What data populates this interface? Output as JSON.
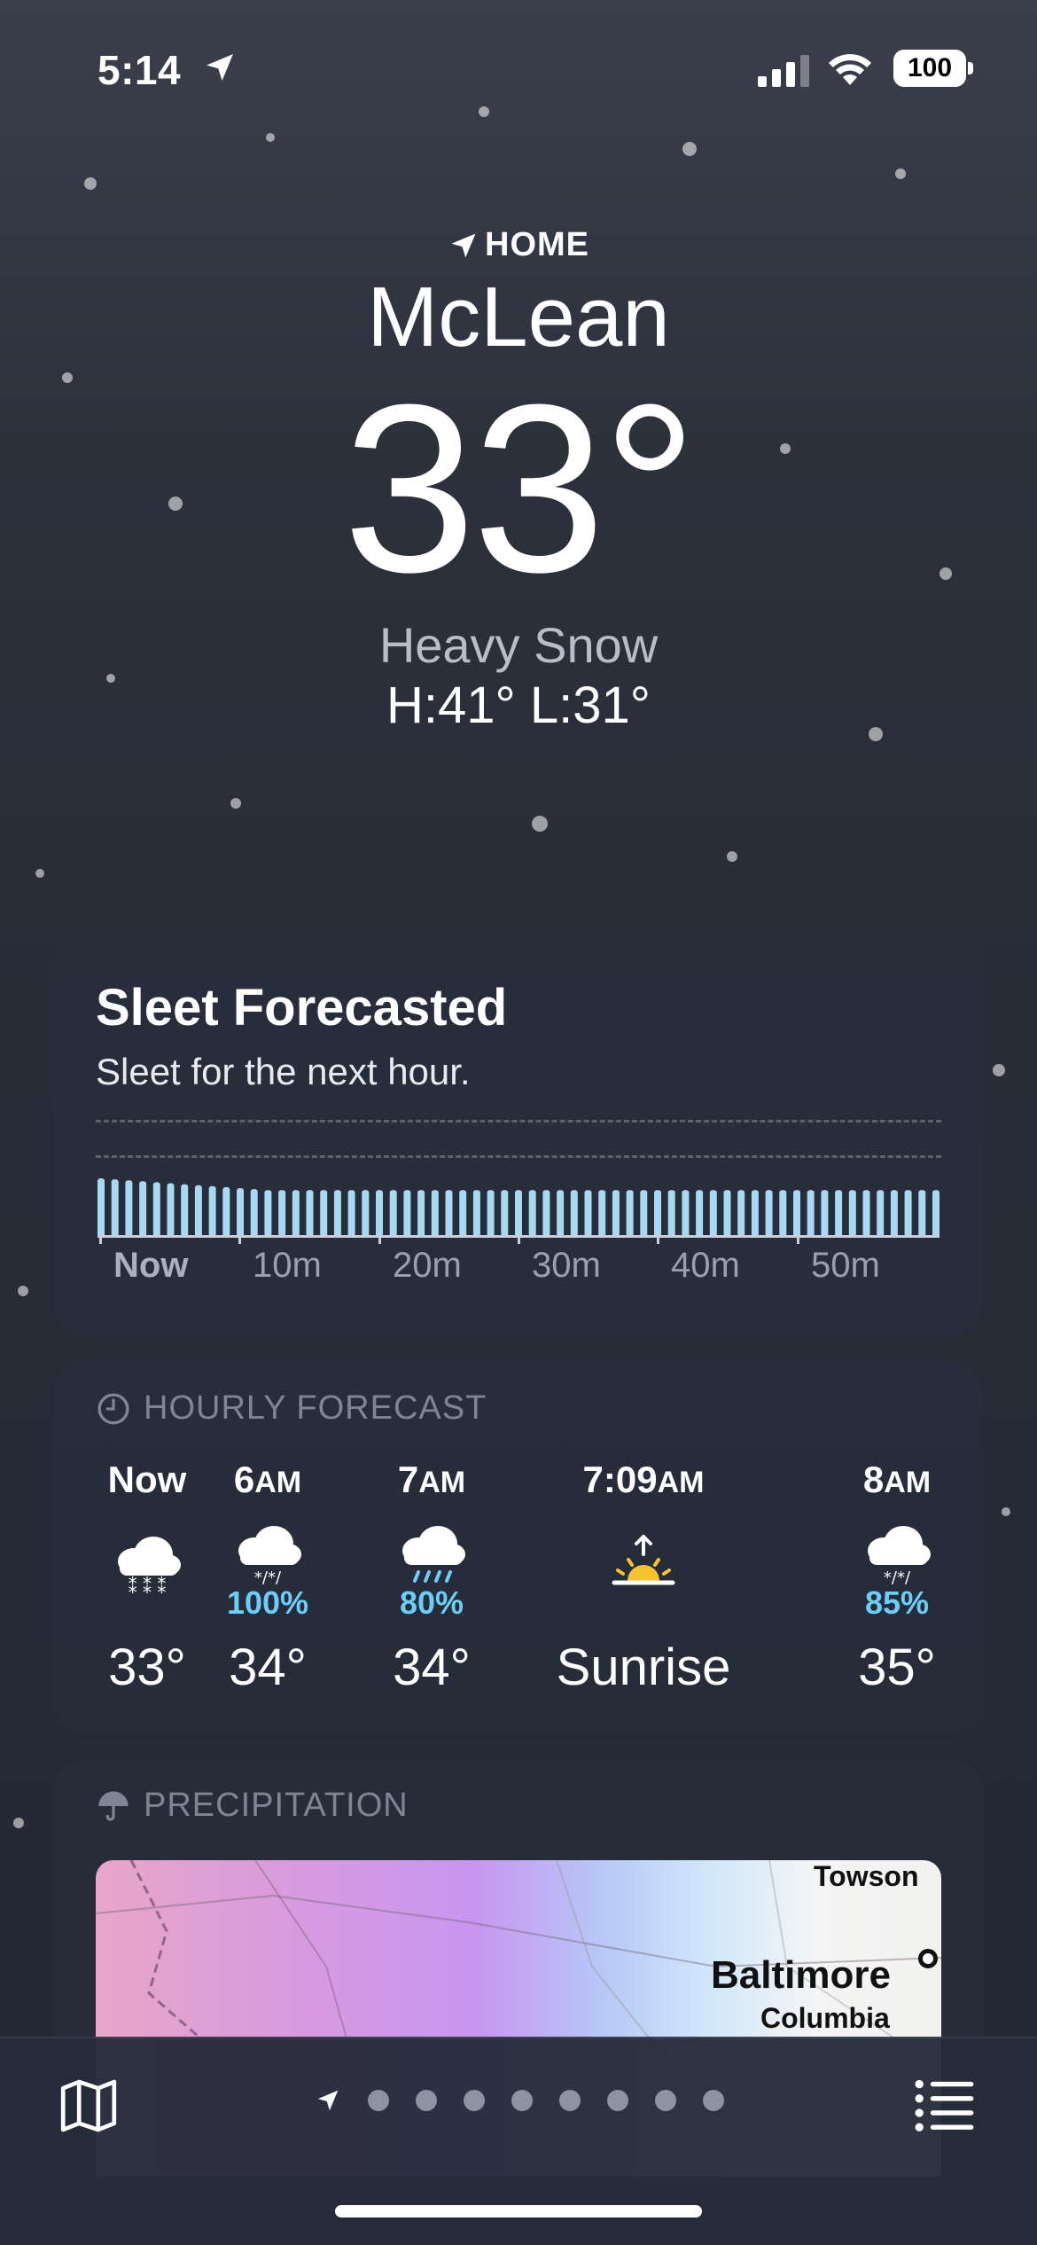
{
  "status_bar": {
    "time": "5:14",
    "battery": "100"
  },
  "header": {
    "location_label": "HOME",
    "city": "McLean",
    "temperature": "33°",
    "condition": "Heavy Snow",
    "high_low": "H:41°  L:31°"
  },
  "precip_card": {
    "title": "Sleet Forecasted",
    "subtitle": "Sleet for the next hour.",
    "axis_labels": [
      "Now",
      "10m",
      "20m",
      "30m",
      "40m",
      "50m"
    ]
  },
  "hourly": {
    "section_title": "HOURLY FORECAST",
    "items": [
      {
        "time": "Now",
        "time_suffix": "",
        "icon": "snow-cloud-icon",
        "pct": "",
        "temp": "33°"
      },
      {
        "time": "6",
        "time_suffix": "AM",
        "icon": "sleet-cloud-icon",
        "pct": "100%",
        "temp": "34°"
      },
      {
        "time": "7",
        "time_suffix": "AM",
        "icon": "rain-cloud-icon",
        "pct": "80%",
        "temp": "34°"
      },
      {
        "time": "7:09",
        "time_suffix": "AM",
        "icon": "sunrise-icon",
        "pct": "",
        "temp": "Sunrise"
      },
      {
        "time": "8",
        "time_suffix": "AM",
        "icon": "sleet-cloud-icon",
        "pct": "85%",
        "temp": "35°"
      }
    ]
  },
  "precipitation": {
    "section_title": "PRECIPITATION",
    "map_labels": [
      "Towson",
      "Baltimore",
      "Columbia"
    ]
  },
  "colors": {
    "precip_bar": "#a9d8f3",
    "pct_blue": "#6ecdf7",
    "sun": "#f5c330"
  },
  "icons": {
    "map": "map-icon",
    "list": "list-icon",
    "location": "location-arrow-icon"
  },
  "page_dots": 8
}
